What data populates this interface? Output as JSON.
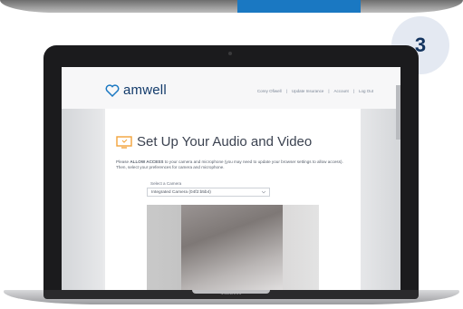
{
  "step_badge": {
    "number": "3"
  },
  "app": {
    "logo_text": "amwell",
    "nav": [
      "Corey Ofiwell",
      "|",
      "Update Insurance",
      "|",
      "Account",
      "|",
      "Log Out"
    ]
  },
  "setup": {
    "title": "Set Up Your Audio and Video",
    "instructions_prefix": "Please ",
    "instructions_bold": "ALLOW ACCESS",
    "instructions_rest": " to your camera and microphone (you may need to update your browser settings to allow access). Then, select your preferences for camera and microphone.",
    "camera_label": "Select a Camera",
    "camera_value": "Integrated Camera (04f2:b5b4)"
  },
  "device": {
    "brand": "MacBook"
  },
  "colors": {
    "accent": "#1a78c2",
    "badge_bg": "#e4e9f2",
    "badge_text": "#12335e",
    "logo": "#133b6b"
  }
}
